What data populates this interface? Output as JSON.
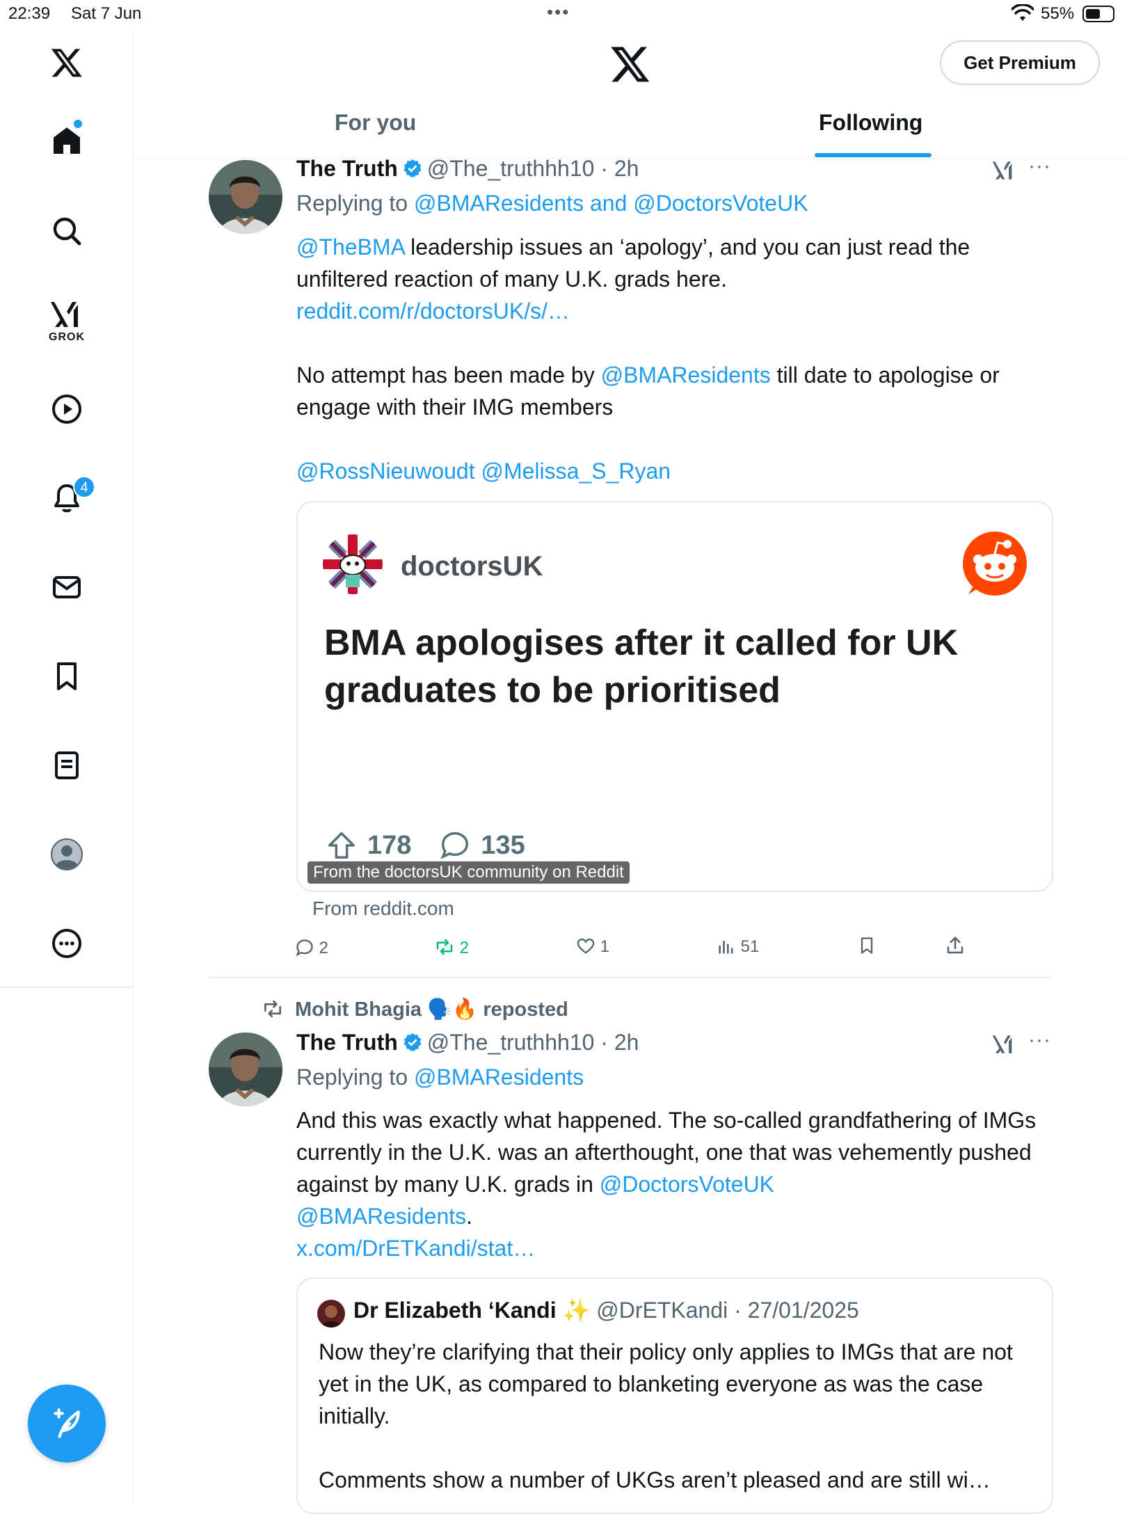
{
  "status_bar": {
    "time": "22:39",
    "date": "Sat 7 Jun",
    "battery": "55%",
    "battery_fraction": 0.55
  },
  "sidebar": {
    "grok_label": "GROK",
    "notifications_count": "4",
    "items": [
      "home-icon",
      "search-icon",
      "grok-icon",
      "play-icon",
      "bell-icon",
      "mail-icon",
      "bookmark-icon",
      "list-icon",
      "profile-icon",
      "more-icon"
    ]
  },
  "header": {
    "premium_label": "Get Premium",
    "tabs": [
      {
        "label": "For you"
      },
      {
        "label": "Following",
        "selected": true
      }
    ]
  },
  "tweets": [
    {
      "author": "The Truth",
      "handle": "@The_truthhh10",
      "time": "2h",
      "replying_label": "Replying to",
      "replying_to": "@BMAResidents and @DoctorsVoteUK",
      "body": {
        "mention1": "@TheBMA",
        "text1": " leadership issues an ‘apology’, and you can just read the unfiltered reaction of many U.K. grads here.",
        "link": "reddit.com/r/doctorsUK/s/…",
        "text2_a": "No attempt has been made by ",
        "mention2": "@BMAResidents",
        "text2_b": " till date to apologise or engage with their IMG members",
        "mentions3": "@RossNieuwoudt @Melissa_S_Ryan"
      },
      "card": {
        "subreddit": "doctorsUK",
        "headline": "BMA apologises after it called for UK graduates to be prioritised",
        "upvotes": "178",
        "comments": "135",
        "tooltip": "From the doctorsUK community on Reddit",
        "source": "From reddit.com"
      },
      "stats": {
        "replies": "2",
        "reposts": "2",
        "likes": "1",
        "views": "51"
      }
    },
    {
      "repost_by": "Mohit Bhagia 🗣️🔥",
      "repost_label": "reposted",
      "author": "The Truth",
      "handle": "@The_truthhh10",
      "time": "2h",
      "replying_label": "Replying to",
      "replying_to": "@BMAResidents",
      "body": {
        "text1": "And this was exactly what happened. The so-called grandfathering of IMGs currently in the U.K. was an afterthought, one that was vehemently pushed against by many U.K. grads in ",
        "mention1": "@DoctorsVoteUK",
        "mention2": "@BMAResidents",
        "text2": ".",
        "link": "x.com/DrETKandi/stat…"
      },
      "quote": {
        "author": "Dr Elizabeth ‘Kandi",
        "emoji": "✨",
        "handle": "@DrETKandi",
        "date": "27/01/2025",
        "text1": "Now they’re clarifying that their policy only applies to IMGs that are not yet in the UK, as compared to blanketing everyone as was the case initially.",
        "text2": "Comments show a number of UKGs aren’t pleased and are still wi…"
      }
    }
  ]
}
